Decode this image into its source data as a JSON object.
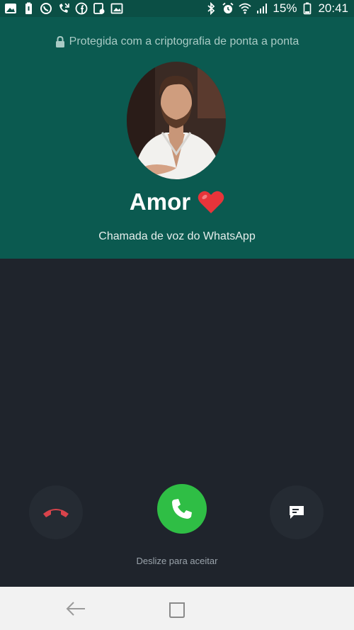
{
  "status_bar": {
    "battery_percent": "15%",
    "time": "20:41",
    "left_icons": [
      "image-icon",
      "battery-saver-icon",
      "whatsapp-icon",
      "missed-call-icon",
      "facebook-icon",
      "screen-record-icon",
      "gallery-icon"
    ],
    "right_icons": [
      "bluetooth-icon",
      "alarm-icon",
      "wifi-icon",
      "signal-icon",
      "battery-icon"
    ]
  },
  "call": {
    "encryption_text": "Protegida com a criptografia de ponta a ponta",
    "contact_name": "Amor",
    "call_type": "Chamada de voz do WhatsApp",
    "slide_hint": "Deslize para aceitar"
  },
  "actions": {
    "decline_icon": "hang-up-icon",
    "accept_icon": "phone-icon",
    "message_icon": "message-icon"
  },
  "colors": {
    "header": "#0b5a50",
    "status_bar": "#0b4f45",
    "background": "#1f242c",
    "accept": "#2fbe45",
    "decline": "#d9434b",
    "heart": "#e8343a"
  }
}
